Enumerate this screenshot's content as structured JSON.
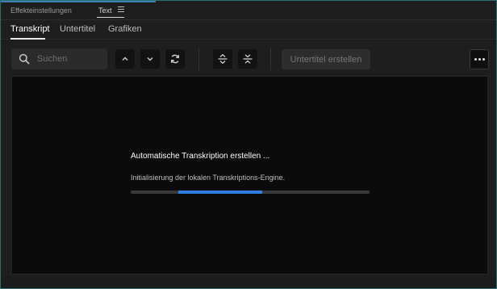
{
  "panel": {
    "tabs": [
      {
        "label": "Effekteinstellungen"
      },
      {
        "label": "Text"
      }
    ],
    "menu_icon": "hamburger-icon"
  },
  "subtabs": [
    {
      "label": "Transkript",
      "active": true
    },
    {
      "label": "Untertitel",
      "active": false
    },
    {
      "label": "Grafiken",
      "active": false
    }
  ],
  "toolbar": {
    "search": {
      "placeholder": "Suchen",
      "value": "",
      "icon": "search-icon"
    },
    "buttons": [
      {
        "icon": "chevron-up-icon"
      },
      {
        "icon": "chevron-down-icon"
      },
      {
        "icon": "refresh-icon"
      },
      {
        "icon": "expand-vertical-icon"
      },
      {
        "icon": "collapse-vertical-icon"
      }
    ],
    "create_label": "Untertitel erstellen",
    "more_icon": "more-icon"
  },
  "status": {
    "title": "Automatische Transkription erstellen ...",
    "message": "Initialisierung der lokalen Transkriptions-Engine.",
    "progress_start": 0.2,
    "progress_end": 0.55
  },
  "colors": {
    "accent": "#2f7fe0",
    "background": "#1e1e1e",
    "content_bg": "#0b0b0b"
  }
}
